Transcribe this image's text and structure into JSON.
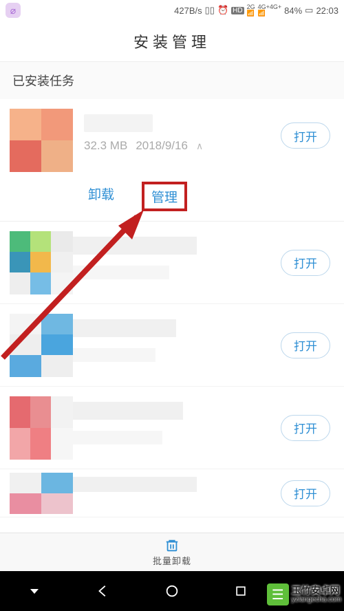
{
  "status": {
    "speed": "427B/s",
    "battery_pct": "84%",
    "time": "22:03",
    "net2g_top": "2G",
    "net4g_top": "4G+4G+",
    "hd_badge": "HD"
  },
  "title": "安装管理",
  "section_header": "已安装任务",
  "app": {
    "size": "32.3 MB",
    "date": "2018/9/16"
  },
  "actions": {
    "uninstall": "卸载",
    "manage": "管理"
  },
  "open_label": "打开",
  "bottom": {
    "batch_uninstall": "批量卸载"
  },
  "watermark": {
    "cn": "玉竹安卓网",
    "en": "yzlangecha.com"
  }
}
